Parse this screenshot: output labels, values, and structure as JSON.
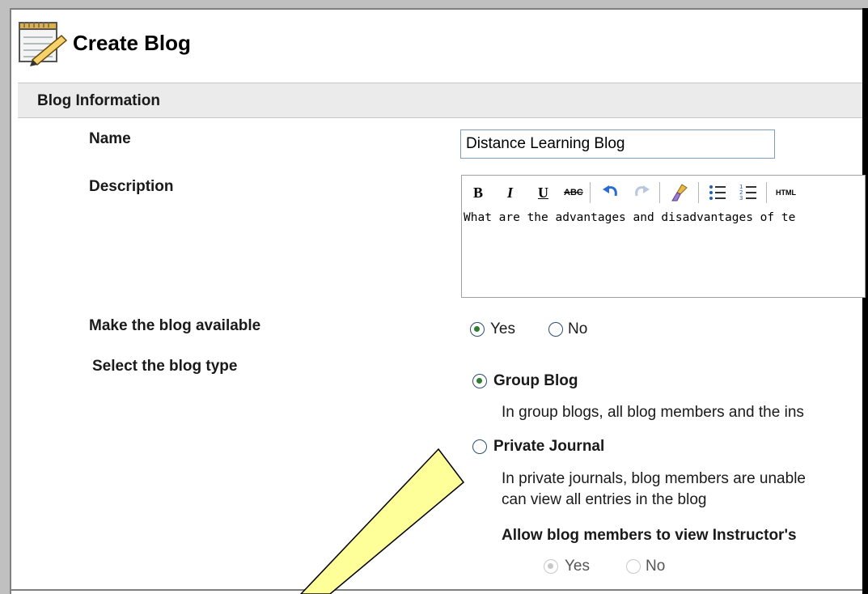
{
  "page": {
    "title": "Create Blog"
  },
  "section": {
    "title": "Blog Information"
  },
  "fields": {
    "name": {
      "label": "Name",
      "value": "Distance Learning Blog"
    },
    "description": {
      "label": "Description",
      "text": "What are the advantages and disadvantages of te",
      "toolbar": [
        "B",
        "I",
        "U",
        "ABC",
        "undo",
        "redo",
        "clean-format",
        "bullet-list",
        "numbered-list",
        "HTML"
      ]
    },
    "available": {
      "label": "Make the blog available",
      "yes": "Yes",
      "no": "No",
      "selected": "Yes"
    },
    "blog_type": {
      "label": "Select the blog type",
      "options": [
        {
          "title": "Group Blog",
          "desc": [
            "In group blogs, all blog members and the ins"
          ],
          "selected": true
        },
        {
          "title": "Private Journal",
          "desc": [
            "In private journals, blog members are unable",
            "can view all entries in the blog"
          ],
          "selected": false
        }
      ],
      "instructor": {
        "label": "Allow blog members to view Instructor's",
        "yes": "Yes",
        "no": "No",
        "selected": "Yes",
        "enabled": false
      }
    }
  },
  "colors": {
    "section_bg": "#ebebeb",
    "arrow_fill": "#ffff99",
    "radio_check": "#2e7d32"
  }
}
